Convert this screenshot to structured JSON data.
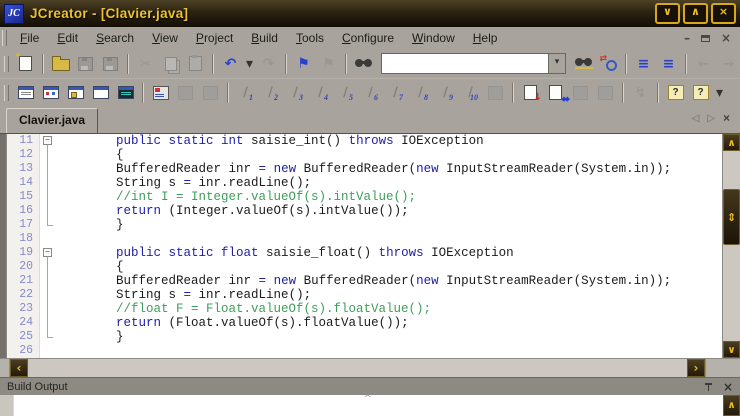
{
  "titlebar": {
    "icon_text": "JC",
    "title": "JCreator - [Clavier.java]",
    "buttons": [
      {
        "n": "minimize-button",
        "g": "∨"
      },
      {
        "n": "maximize-button",
        "g": "∧"
      },
      {
        "n": "close-button",
        "g": "×"
      }
    ]
  },
  "menubar": {
    "items": [
      "File",
      "Edit",
      "Search",
      "View",
      "Project",
      "Build",
      "Tools",
      "Configure",
      "Window",
      "Help"
    ],
    "mdi": [
      {
        "n": "mdi-minimize-button",
        "g": "–"
      },
      {
        "n": "mdi-restore-button",
        "css": "ic-rst"
      },
      {
        "n": "mdi-close-button",
        "g": "×"
      }
    ]
  },
  "toolbar1": {
    "search_value": "",
    "items": [
      {
        "n": "new-file-button",
        "k": "css",
        "c": "ic-page ic-page-new"
      },
      {
        "k": "sep"
      },
      {
        "n": "open-file-button",
        "k": "css",
        "c": "ic-folder"
      },
      {
        "n": "save-button",
        "k": "css",
        "c": "ic-disk",
        "d": 1
      },
      {
        "n": "save-all-button",
        "k": "css",
        "c": "ic-disk",
        "d": 1
      },
      {
        "k": "sep"
      },
      {
        "n": "cut-button",
        "k": "char",
        "g": "✂",
        "f": "dis"
      },
      {
        "n": "copy-button",
        "k": "css",
        "c": "ic-copy",
        "d": 1
      },
      {
        "n": "paste-button",
        "k": "css",
        "c": "ic-paste",
        "d": 1
      },
      {
        "k": "sep"
      },
      {
        "n": "undo-button",
        "k": "char",
        "g": "↶",
        "f": "#2a3fd0"
      },
      {
        "n": "undo-dropdown",
        "k": "char",
        "g": "▾",
        "f": "#333",
        "narrow": 1
      },
      {
        "n": "redo-button",
        "k": "char",
        "g": "↷",
        "f": "dis"
      },
      {
        "k": "sep"
      },
      {
        "n": "toggle-bookmark-button",
        "k": "char",
        "g": "⚑",
        "f": "#2a3fd0"
      },
      {
        "n": "clear-bookmarks-button",
        "k": "char",
        "g": "⚑",
        "f": "dis"
      },
      {
        "k": "sep"
      },
      {
        "n": "find-button",
        "k": "css",
        "c": "ic-binoc"
      },
      {
        "n": "search-combobox",
        "k": "combo"
      },
      {
        "n": "find-in-files-button",
        "k": "css",
        "c": "ic-binoc ic-binoc-files"
      },
      {
        "n": "replace-button",
        "k": "css",
        "c": "ic-replace"
      },
      {
        "k": "sep"
      },
      {
        "n": "indent-button",
        "k": "char",
        "g": "≡",
        "f": "#2a3fd0"
      },
      {
        "n": "outdent-button",
        "k": "char",
        "g": "≡",
        "f": "#2a3fd0"
      },
      {
        "k": "sep"
      },
      {
        "n": "back-button",
        "k": "char",
        "g": "←",
        "f": "dis"
      },
      {
        "n": "forward-button",
        "k": "char",
        "g": "→",
        "f": "dis"
      },
      {
        "n": "toolbar1-options-dropdown",
        "k": "char",
        "g": "▾",
        "f": "#333",
        "narrow": 1
      }
    ]
  },
  "toolbar2": {
    "items": [
      {
        "n": "view-workspace-button",
        "k": "css",
        "c": "ic-win ic-win-lines"
      },
      {
        "n": "view-properties-button",
        "k": "css",
        "c": "ic-win ic-win-dots"
      },
      {
        "n": "view-files-button",
        "k": "css",
        "c": "ic-win ic-win-gold"
      },
      {
        "n": "view-document-button",
        "k": "css",
        "c": "ic-win"
      },
      {
        "n": "view-output-button",
        "k": "css",
        "c": "ic-win ic-win-teal"
      },
      {
        "k": "sep"
      },
      {
        "n": "project-settings-button",
        "k": "css",
        "c": "ic-proj"
      },
      {
        "n": "add-file-button",
        "k": "css",
        "c": "ic-sq",
        "d": 1
      },
      {
        "n": "remove-file-button",
        "k": "css",
        "c": "ic-sq",
        "d": 1
      },
      {
        "k": "sep"
      },
      {
        "n": "tool-1-button",
        "k": "wrench",
        "num": "1"
      },
      {
        "n": "tool-2-button",
        "k": "wrench",
        "num": "2"
      },
      {
        "n": "tool-3-button",
        "k": "wrench",
        "num": "3"
      },
      {
        "n": "tool-4-button",
        "k": "wrench",
        "num": "4"
      },
      {
        "n": "tool-5-button",
        "k": "wrench",
        "num": "5"
      },
      {
        "n": "tool-6-button",
        "k": "wrench",
        "num": "6"
      },
      {
        "n": "tool-7-button",
        "k": "wrench",
        "num": "7"
      },
      {
        "n": "tool-8-button",
        "k": "wrench",
        "num": "8"
      },
      {
        "n": "tool-9-button",
        "k": "wrench",
        "num": "9"
      },
      {
        "n": "tool-10-button",
        "k": "wrench",
        "num": "10"
      },
      {
        "n": "stop-button",
        "k": "css",
        "c": "ic-sq",
        "d": 1
      },
      {
        "k": "sep"
      },
      {
        "n": "compile-file-button",
        "k": "css",
        "c": "ic-page ic-page-compile"
      },
      {
        "n": "build-file-button",
        "k": "css",
        "c": "ic-page ic-page-build"
      },
      {
        "n": "build-project-button",
        "k": "css",
        "c": "ic-sq",
        "d": 1
      },
      {
        "n": "run-project-button",
        "k": "css",
        "c": "ic-sq",
        "d": 1
      },
      {
        "k": "sep"
      },
      {
        "n": "debug-button",
        "k": "char",
        "g": "↯",
        "f": "dis"
      },
      {
        "k": "sep"
      },
      {
        "n": "help-button",
        "k": "css",
        "c": "ic-help"
      },
      {
        "n": "context-help-button",
        "k": "css",
        "c": "ic-help"
      },
      {
        "n": "toolbar2-options-dropdown",
        "k": "char",
        "g": "▾",
        "f": "#333",
        "narrow": 1
      }
    ]
  },
  "tabbar": {
    "tab_label": "Clavier.java",
    "nav": [
      {
        "n": "tab-scroll-left-button",
        "g": "◁"
      },
      {
        "n": "tab-scroll-right-button",
        "g": "▷"
      },
      {
        "n": "tab-close-button",
        "g": "×",
        "close": 1
      }
    ]
  },
  "editor": {
    "lines": [
      {
        "num": "11",
        "fold": "s",
        "seg": [
          {
            "t": "        ",
            "c": "p"
          },
          {
            "t": "public static int",
            "c": "k"
          },
          {
            "t": " saisie_int() ",
            "c": "p"
          },
          {
            "t": "throws",
            "c": "k"
          },
          {
            "t": " IOException",
            "c": "p"
          }
        ]
      },
      {
        "num": "12",
        "fold": "l",
        "seg": [
          {
            "t": "        {",
            "c": "p"
          }
        ]
      },
      {
        "num": "13",
        "fold": "l",
        "seg": [
          {
            "t": "        BufferedReader inr ",
            "c": "p"
          },
          {
            "t": "=",
            "c": "k"
          },
          {
            "t": " ",
            "c": "p"
          },
          {
            "t": "new",
            "c": "k"
          },
          {
            "t": " BufferedReader(",
            "c": "p"
          },
          {
            "t": "new",
            "c": "k"
          },
          {
            "t": " InputStreamReader(System.in));",
            "c": "p"
          }
        ]
      },
      {
        "num": "14",
        "fold": "l",
        "seg": [
          {
            "t": "        String s ",
            "c": "p"
          },
          {
            "t": "=",
            "c": "k"
          },
          {
            "t": " inr.readLine();",
            "c": "p"
          }
        ]
      },
      {
        "num": "15",
        "fold": "l",
        "seg": [
          {
            "t": "        //int I = Integer.valueOf(s).intValue();",
            "c": "c"
          }
        ]
      },
      {
        "num": "16",
        "fold": "l",
        "seg": [
          {
            "t": "        ",
            "c": "p"
          },
          {
            "t": "return",
            "c": "k"
          },
          {
            "t": " (Integer.valueOf(s).intValue());",
            "c": "p"
          }
        ]
      },
      {
        "num": "17",
        "fold": "e",
        "seg": [
          {
            "t": "        }",
            "c": "p"
          }
        ]
      },
      {
        "num": "18",
        "fold": "",
        "seg": []
      },
      {
        "num": "19",
        "fold": "s",
        "seg": [
          {
            "t": "        ",
            "c": "p"
          },
          {
            "t": "public static float",
            "c": "k"
          },
          {
            "t": " saisie_float() ",
            "c": "p"
          },
          {
            "t": "throws",
            "c": "k"
          },
          {
            "t": " IOException",
            "c": "p"
          }
        ]
      },
      {
        "num": "20",
        "fold": "l",
        "seg": [
          {
            "t": "        {",
            "c": "p"
          }
        ]
      },
      {
        "num": "21",
        "fold": "l",
        "seg": [
          {
            "t": "        BufferedReader inr ",
            "c": "p"
          },
          {
            "t": "=",
            "c": "k"
          },
          {
            "t": " ",
            "c": "p"
          },
          {
            "t": "new",
            "c": "k"
          },
          {
            "t": " BufferedReader(",
            "c": "p"
          },
          {
            "t": "new",
            "c": "k"
          },
          {
            "t": " InputStreamReader(System.in));",
            "c": "p"
          }
        ]
      },
      {
        "num": "22",
        "fold": "l",
        "seg": [
          {
            "t": "        String s ",
            "c": "p"
          },
          {
            "t": "=",
            "c": "k"
          },
          {
            "t": " inr.readLine();",
            "c": "p"
          }
        ]
      },
      {
        "num": "23",
        "fold": "l",
        "seg": [
          {
            "t": "        //float F = Float.valueOf(s).floatValue();",
            "c": "c"
          }
        ]
      },
      {
        "num": "24",
        "fold": "l",
        "seg": [
          {
            "t": "        ",
            "c": "p"
          },
          {
            "t": "return",
            "c": "k"
          },
          {
            "t": " (Float.valueOf(s).floatValue());",
            "c": "p"
          }
        ]
      },
      {
        "num": "25",
        "fold": "e",
        "seg": [
          {
            "t": "        }",
            "c": "p"
          }
        ]
      },
      {
        "num": "26",
        "fold": "",
        "seg": []
      }
    ],
    "colors": {
      "keyword": "#2121a8",
      "comment": "#3d9e5a",
      "plain": "#1b1b1b",
      "line_number": "#8a8ac8"
    }
  },
  "scroll": {
    "up": "∧",
    "down": "∨",
    "thumb": "⇕",
    "left": "‹",
    "right": "›"
  },
  "build": {
    "title": "Build Output",
    "close_glyph": "×",
    "grip_glyph": "^",
    "scroll_up_glyph": "∧"
  }
}
